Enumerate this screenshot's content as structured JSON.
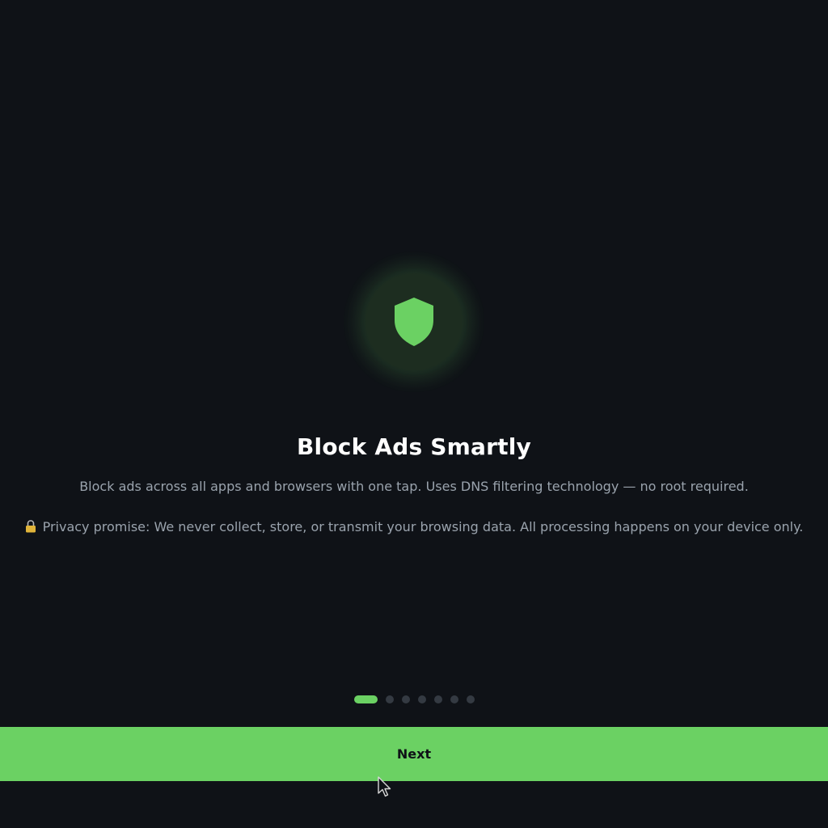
{
  "onboarding": {
    "title": "Block Ads Smartly",
    "description": "Block ads across all apps and browsers with one tap. Uses DNS filtering technology — no root required.",
    "privacy_text": "Privacy promise: We never collect, store, or transmit your browsing data. All processing happens on your device only.",
    "hero_icon": "shield-icon",
    "privacy_icon": "lock-icon"
  },
  "pager": {
    "total_pages": 7,
    "current_page": 1
  },
  "footer": {
    "next_label": "Next"
  },
  "colors": {
    "background": "#0f1217",
    "accent": "#6bd163",
    "text_primary": "#ffffff",
    "text_secondary": "#9aa3ad"
  }
}
